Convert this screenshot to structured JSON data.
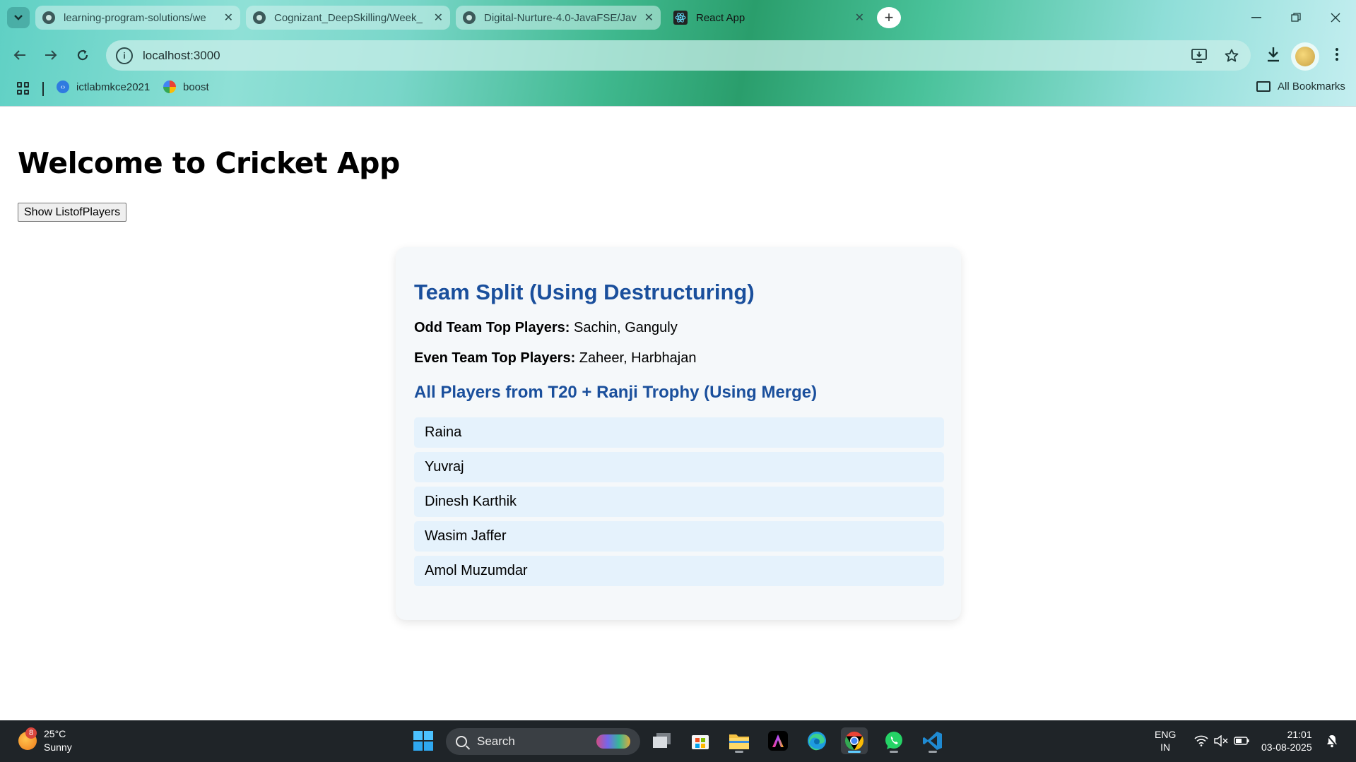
{
  "browser": {
    "tabs": [
      {
        "title": "learning-program-solutions/we",
        "state": "inactive",
        "favicon": "github-icon"
      },
      {
        "title": "Cognizant_DeepSkilling/Week_",
        "state": "inactive",
        "favicon": "github-icon"
      },
      {
        "title": "Digital-Nurture-4.0-JavaFSE/Jav",
        "state": "inactive",
        "favicon": "github-icon"
      },
      {
        "title": "React App",
        "state": "active",
        "favicon": "react-icon"
      }
    ],
    "url": "localhost:3000",
    "bookmarks": [
      {
        "label": "ictlabmkce2021"
      },
      {
        "label": "boost"
      }
    ],
    "all_bookmarks_label": "All Bookmarks"
  },
  "page": {
    "title": "Welcome to Cricket App",
    "show_button_label": "Show ListofPlayers",
    "card": {
      "heading": "Team Split (Using Destructuring)",
      "odd_team": {
        "label": "Odd Team Top Players:",
        "value": "Sachin, Ganguly"
      },
      "even_team": {
        "label": "Even Team Top Players:",
        "value": "Zaheer, Harbhajan"
      },
      "merge_heading": "All Players from T20 + Ranji Trophy (Using Merge)",
      "players": [
        "Raina",
        "Yuvraj",
        "Dinesh Karthik",
        "Wasim Jaffer",
        "Amol Muzumdar"
      ]
    },
    "colors": {
      "heading_blue": "#1a4f9c",
      "list_item_bg": "#e5f2fc",
      "card_bg": "#f5f8fa"
    }
  },
  "taskbar": {
    "weather": {
      "badge": "8",
      "temp": "25°C",
      "condition": "Sunny"
    },
    "search_placeholder": "Search",
    "language": {
      "line1": "ENG",
      "line2": "IN"
    },
    "clock": {
      "time": "21:01",
      "date": "03-08-2025"
    }
  }
}
